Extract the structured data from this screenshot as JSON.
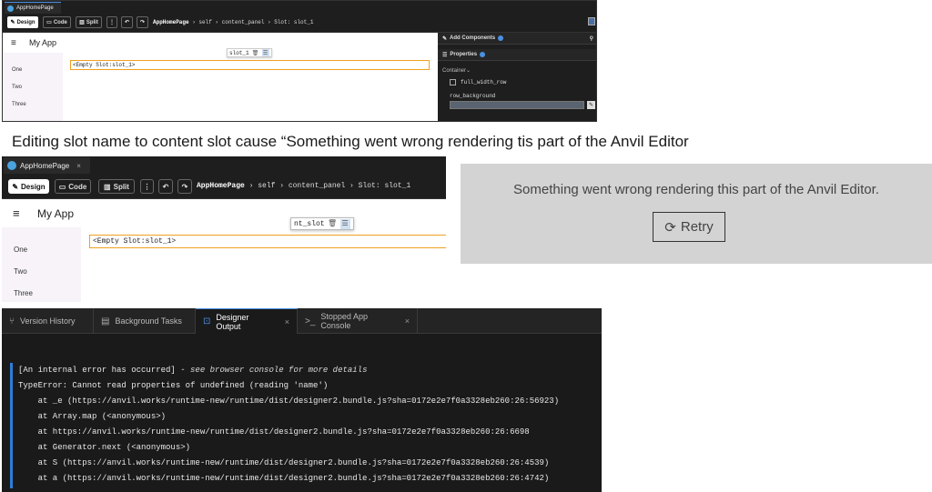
{
  "panel1": {
    "tab_title": "AppHomePage",
    "toolbar": {
      "design": "Design",
      "code": "Code",
      "split": "Split"
    },
    "breadcrumb": {
      "page": "AppHomePage",
      "path": "› self › content_panel › Slot: slot_1"
    },
    "app_title": "My App",
    "nav": [
      "One",
      "Two",
      "Three"
    ],
    "slot_chip": "slot_1",
    "empty_slot": "<Empty Slot:slot_1>",
    "props": {
      "add_components": "Add Components",
      "properties": "Properties",
      "section": "Container",
      "checkbox_label": "full_width_row",
      "field_label": "row_background"
    }
  },
  "caption": "Editing slot name to content slot cause “Something went wrong rendering tis part of the Anvil Editor",
  "panel2": {
    "tab_title": "AppHomePage",
    "toolbar": {
      "design": "Design",
      "code": "Code",
      "split": "Split"
    },
    "breadcrumb": {
      "page": "AppHomePage",
      "path": "› self › content_panel › Slot: slot_1"
    },
    "app_title": "My App",
    "nav": [
      "One",
      "Two",
      "Three"
    ],
    "slot_chip": "nt_slot",
    "empty_slot": "<Empty Slot:slot_1>"
  },
  "error": {
    "message": "Something went wrong rendering this part of the Anvil Editor.",
    "retry": "Retry"
  },
  "console": {
    "tabs": [
      {
        "label": "Version History",
        "icon": "branch-icon"
      },
      {
        "label": "Background Tasks",
        "icon": "tasks-icon"
      },
      {
        "label": "Designer Output",
        "icon": "designer-icon",
        "active": true
      },
      {
        "label": "Stopped App Console",
        "icon": "terminal-icon"
      }
    ],
    "error_head": "[An internal error has occurred]",
    "error_note": "- see browser console for more details",
    "lines": [
      "TypeError: Cannot read properties of undefined (reading 'name')",
      "    at _e (https://anvil.works/runtime-new/runtime/dist/designer2.bundle.js?sha=0172e2e7f0a3328eb260:26:56923)",
      "    at Array.map (<anonymous>)",
      "    at https://anvil.works/runtime-new/runtime/dist/designer2.bundle.js?sha=0172e2e7f0a3328eb260:26:6698",
      "    at Generator.next (<anonymous>)",
      "    at S (https://anvil.works/runtime-new/runtime/dist/designer2.bundle.js?sha=0172e2e7f0a3328eb260:26:4539)",
      "    at a (https://anvil.works/runtime-new/runtime/dist/designer2.bundle.js?sha=0172e2e7f0a3328eb260:26:4742)"
    ]
  }
}
